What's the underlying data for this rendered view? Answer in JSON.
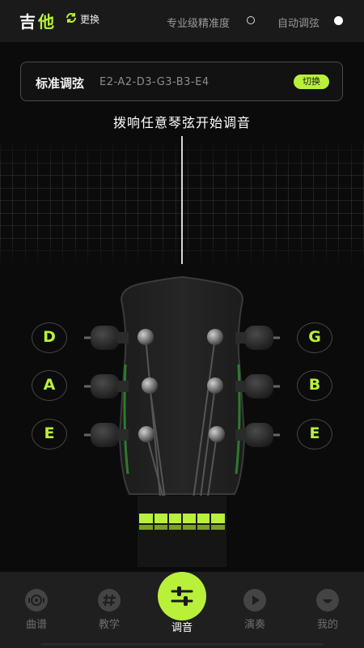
{
  "header": {
    "brand_char1": "吉",
    "brand_char2": "他",
    "swap_label": "更换",
    "pro_precision_label": "专业级精准度",
    "auto_tune_label": "自动调弦"
  },
  "tuning": {
    "name": "标准调弦",
    "notes": "E2-A2-D3-G3-B3-E4",
    "switch_label": "切换"
  },
  "hint": "拨响任意琴弦开始调音",
  "strings": {
    "left": [
      "D",
      "A",
      "E"
    ],
    "right": [
      "G",
      "B",
      "E"
    ]
  },
  "nav": {
    "items": [
      "曲谱",
      "教学",
      "调音",
      "演奏",
      "我的"
    ],
    "active_index": 2
  },
  "colors": {
    "accent": "#b8f03a",
    "background": "#0b0b0b",
    "bar": "#1f1f1f"
  }
}
